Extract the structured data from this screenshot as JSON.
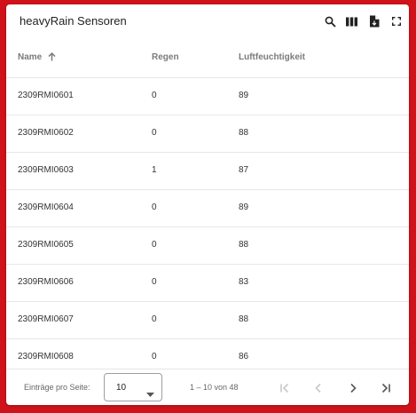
{
  "table": {
    "title": "heavyRain Sensoren",
    "toolbar_icons": [
      "search-icon",
      "columns-icon",
      "export-icon",
      "fullscreen-icon"
    ],
    "columns": [
      {
        "label": "Name",
        "sort": "ascending"
      },
      {
        "label": "Regen"
      },
      {
        "label": "Luftfeuchtigkeit"
      }
    ],
    "rows": [
      [
        "2309RMI0601",
        "0",
        "89"
      ],
      [
        "2309RMI0602",
        "0",
        "88"
      ],
      [
        "2309RMI0603",
        "1",
        "87"
      ],
      [
        "2309RMI0604",
        "0",
        "89"
      ],
      [
        "2309RMI0605",
        "0",
        "88"
      ],
      [
        "2309RMI0606",
        "0",
        "83"
      ],
      [
        "2309RMI0607",
        "0",
        "88"
      ],
      [
        "2309RMI0608",
        "0",
        "86"
      ]
    ]
  },
  "pagination": {
    "rows_per_page_label": "Einträge pro Seite:",
    "rows_per_page_value": "10",
    "range_text": "1 – 10 von 48",
    "controls": [
      "first-page-icon",
      "previous-page-icon",
      "next-page-icon",
      "last-page-icon"
    ]
  },
  "colors": {
    "background": "#d0131b",
    "card": "#ffffff",
    "header_text": "#7a7a7a",
    "disabled_icon": "#c8c8c8",
    "active_icon": "#555555"
  }
}
